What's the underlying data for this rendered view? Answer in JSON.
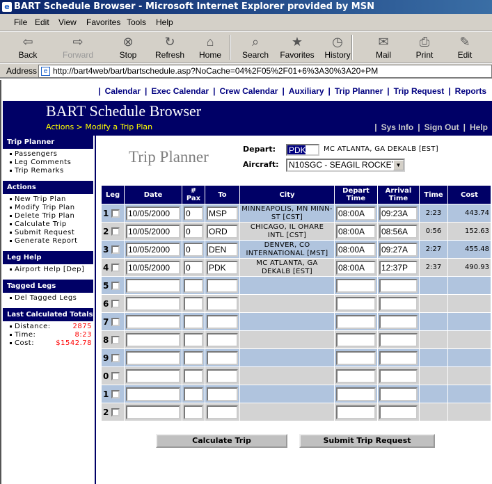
{
  "window": {
    "title": "BART Schedule Browser - Microsoft Internet Explorer provided by MSN"
  },
  "menu": [
    "File",
    "Edit",
    "View",
    "Favorites",
    "Tools",
    "Help"
  ],
  "toolbar": [
    {
      "label": "Back",
      "icon": "⇦"
    },
    {
      "label": "Forward",
      "icon": "⇨"
    },
    {
      "label": "Stop",
      "icon": "⊗"
    },
    {
      "label": "Refresh",
      "icon": "↻"
    },
    {
      "label": "Home",
      "icon": "⌂"
    },
    {
      "label": "Search",
      "icon": "⌕"
    },
    {
      "label": "Favorites",
      "icon": "★"
    },
    {
      "label": "History",
      "icon": "◷"
    },
    {
      "label": "Mail",
      "icon": "✉"
    },
    {
      "label": "Print",
      "icon": "⎙"
    },
    {
      "label": "Edit",
      "icon": "✎"
    }
  ],
  "address": {
    "label": "Address",
    "url": "http://bart4web/bart/bartschedule.asp?NoCache=04%2F05%2F01+6%3A30%3A20+PM"
  },
  "nav": [
    "Calendar",
    "Exec Calendar",
    "Crew Calendar",
    "Auxiliary",
    "Trip Planner",
    "Trip Request",
    "Reports"
  ],
  "header": {
    "title": "BART Schedule Browser",
    "breadcrumb": "Actions > Modify a Trip Plan",
    "links": [
      "Sys Info",
      "Sign Out",
      "Help"
    ]
  },
  "sidebar": [
    {
      "title": "Trip Planner",
      "items": [
        "Passengers",
        "Leg Comments",
        "Trip Remarks"
      ]
    },
    {
      "title": "Actions",
      "items": [
        "New Trip Plan",
        "Modify Trip Plan",
        "Delete Trip Plan",
        "Calculate Trip",
        "Submit Request",
        "Generate Report"
      ]
    },
    {
      "title": "Leg Help",
      "items": [
        "Airport Help [Dep]"
      ]
    },
    {
      "title": "Tagged Legs",
      "items": [
        "Del Tagged Legs"
      ]
    }
  ],
  "totals": {
    "title": "Last Calculated Totals",
    "items": [
      {
        "label": "Distance:",
        "value": "2875"
      },
      {
        "label": "Time:",
        "value": "8:23"
      },
      {
        "label": "Cost:",
        "value": "$1542.78"
      }
    ]
  },
  "form": {
    "title": "Trip Planner",
    "depart_label": "Depart:",
    "depart": "PDK",
    "depart_city": "MC ATLANTA, GA DEKALB [EST]",
    "aircraft_label": "Aircraft:",
    "aircraft": "N10SGC - SEAGIL ROCKET"
  },
  "table": {
    "headers": [
      "Leg",
      "Date",
      "# Pax",
      "To",
      "City",
      "Depart Time",
      "Arrival Time",
      "Time",
      "Cost"
    ],
    "rows": [
      {
        "n": "1",
        "date": "10/05/2000",
        "pax": "0",
        "to": "MSP",
        "city": "MINNEAPOLIS, MN MINN-ST [CST]",
        "dep": "08:00A",
        "arr": "09:23A",
        "time": "2:23",
        "cost": "443.74"
      },
      {
        "n": "2",
        "date": "10/05/2000",
        "pax": "0",
        "to": "ORD",
        "city": "CHICAGO, IL OHARE INTL [CST]",
        "dep": "08:00A",
        "arr": "08:56A",
        "time": "0:56",
        "cost": "152.63"
      },
      {
        "n": "3",
        "date": "10/05/2000",
        "pax": "0",
        "to": "DEN",
        "city": "DENVER, CO INTERNATIONAL [MST]",
        "dep": "08:00A",
        "arr": "09:27A",
        "time": "2:27",
        "cost": "455.48"
      },
      {
        "n": "4",
        "date": "10/05/2000",
        "pax": "0",
        "to": "PDK",
        "city": "MC ATLANTA, GA DEKALB [EST]",
        "dep": "08:00A",
        "arr": "12:37P",
        "time": "2:37",
        "cost": "490.93"
      },
      {
        "n": "5"
      },
      {
        "n": "6"
      },
      {
        "n": "7"
      },
      {
        "n": "8"
      },
      {
        "n": "9"
      },
      {
        "n": "0"
      },
      {
        "n": "1"
      },
      {
        "n": "2"
      }
    ]
  },
  "buttons": {
    "calculate": "Calculate Trip",
    "submit": "Submit Trip Request"
  }
}
